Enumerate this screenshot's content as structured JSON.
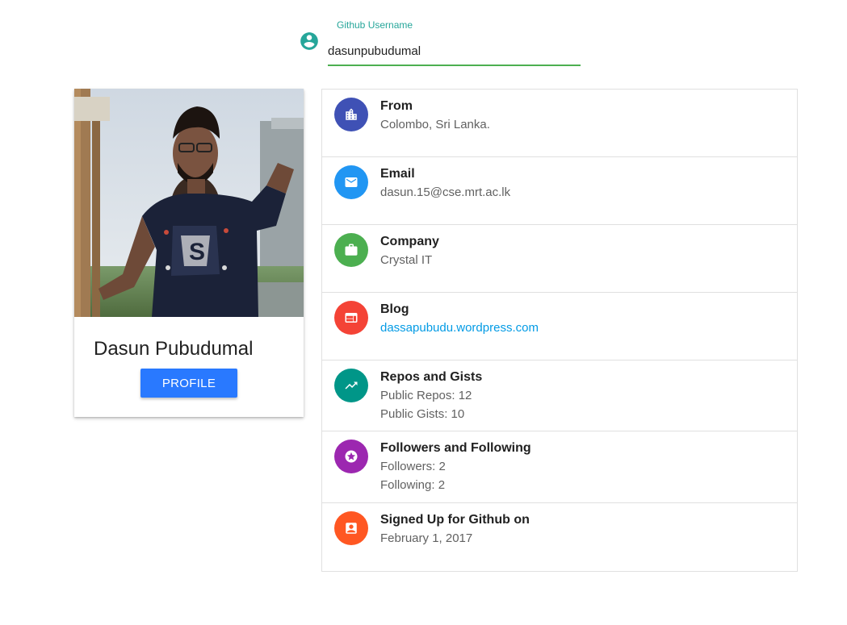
{
  "search": {
    "label": "Github Username",
    "value": "dasunpubudumal",
    "icon": "account-circle-icon",
    "accent": "#26a69a",
    "underline_color": "#4caf50"
  },
  "profile": {
    "name": "Dasun Pubudumal",
    "button_label": "PROFILE",
    "button_color": "#2979ff"
  },
  "details": [
    {
      "icon": "city-icon",
      "color": "#3f51b5",
      "title": "From",
      "lines": [
        "Colombo, Sri Lanka."
      ]
    },
    {
      "icon": "email-icon",
      "color": "#2196f3",
      "title": "Email",
      "lines": [
        "dasun.15@cse.mrt.ac.lk"
      ]
    },
    {
      "icon": "briefcase-icon",
      "color": "#4caf50",
      "title": "Company",
      "lines": [
        "Crystal IT"
      ]
    },
    {
      "icon": "web-icon",
      "color": "#f44336",
      "title": "Blog",
      "lines": [
        "dassapubudu.wordpress.com"
      ]
    },
    {
      "icon": "trending-up-icon",
      "color": "#009688",
      "title": "Repos and Gists",
      "lines": [
        "Public Repos: 12",
        "Public Gists: 10"
      ]
    },
    {
      "icon": "star-circle-icon",
      "color": "#9c27b0",
      "title": "Followers and Following",
      "lines": [
        "Followers: 2",
        "Following: 2"
      ]
    },
    {
      "icon": "account-box-icon",
      "color": "#ff5722",
      "title": "Signed Up for Github on",
      "lines": [
        "February 1, 2017"
      ]
    }
  ]
}
